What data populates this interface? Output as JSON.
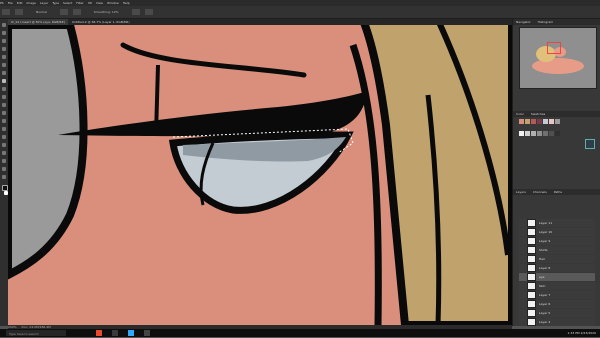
{
  "menubar": {
    "items": [
      "PS",
      "File",
      "Edit",
      "Image",
      "Layer",
      "Type",
      "Select",
      "Filter",
      "3D",
      "View",
      "Window",
      "Help"
    ]
  },
  "optionsbar": {
    "mode_label": "Normal",
    "smoothing_label": "Smoothing: 10%"
  },
  "document": {
    "tab_title": "IC_S1 Lineart @ 50% (eye, RGB/8#)",
    "tab_title_2": "Untitled-2 @ 66.7% (Layer 1, RGB/8#)"
  },
  "status": {
    "zoom": "200%",
    "doc_info": "Doc: 24.0M/186.4M"
  },
  "panel": {
    "tab_navigator": "Navigator",
    "tab_histogram": "Histogram",
    "tab_color": "Color",
    "tab_swatches": "Swatches",
    "layers_label": "Layers",
    "channels_label": "Channels",
    "paths_label": "Paths"
  },
  "layers": [
    {
      "name": "Layer 11",
      "active": false
    },
    {
      "name": "Layer 10",
      "active": false
    },
    {
      "name": "Layer 9",
      "active": false
    },
    {
      "name": "Shirts",
      "active": false
    },
    {
      "name": "Hair",
      "active": false
    },
    {
      "name": "Layer 8",
      "active": false
    },
    {
      "name": "eye",
      "active": true
    },
    {
      "name": "Skin",
      "active": false
    },
    {
      "name": "Layer 7",
      "active": false
    },
    {
      "name": "Layer 6",
      "active": false
    },
    {
      "name": "Layer 5",
      "active": false
    },
    {
      "name": "Layer 4",
      "active": false
    }
  ],
  "colors": {
    "skin": "#d98f7c",
    "hair": "#c0a26c",
    "iris": "#c3ccd3",
    "iris_shade": "#8f9aa3",
    "grey": "#9a9a9a",
    "line": "#0a0a0a"
  },
  "taskbar": {
    "search_placeholder": "Type here to search",
    "time": "1:33 PM",
    "date": "2/23/2020"
  }
}
